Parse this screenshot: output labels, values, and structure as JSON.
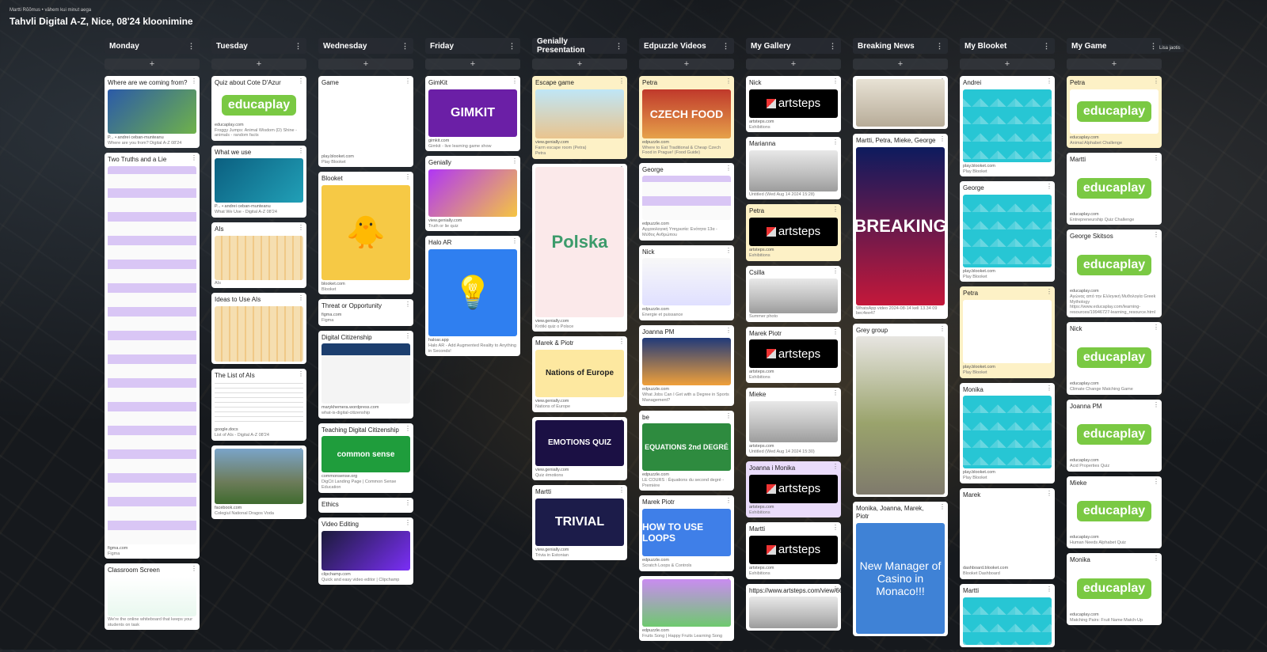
{
  "header": {
    "crumb": "Martti Rõõmus • vähem kui minut aega",
    "title": "Tahvli Digital A-Z, Nice, 08'24 kloonimine"
  },
  "side_label": "Lisa jaotis",
  "columns": [
    {
      "title": "Monday",
      "cards": [
        {
          "title": "Where are we coming from?",
          "style": "white",
          "thumb": "map",
          "thumb_h": 56,
          "domain": "P... • andrei ceban-munteanu",
          "caption": "Where are you from? Digital A-Z 08'24"
        },
        {
          "title": "Two Truths and a Lie",
          "style": "white",
          "thumb": "doc",
          "thumb_h": 478,
          "domain": "figma.com",
          "caption": "Figma"
        },
        {
          "title": "Classroom Screen",
          "style": "white",
          "thumb": "classroom",
          "thumb_h": 50,
          "domain": "",
          "caption": "We're the online whiteboard that keeps your students on task"
        }
      ]
    },
    {
      "title": "Tuesday",
      "cards": [
        {
          "title": "Quiz about Cote D'Azur",
          "style": "white",
          "thumb": "educaplay",
          "thumb_h": 40,
          "domain": "educaplay.com",
          "caption": "Froggy Jumps: Animal Wisdom (D) Shine - animals - random facts"
        },
        {
          "title": "What we use",
          "style": "white",
          "thumb": "ocean",
          "thumb_h": 56,
          "domain": "P... • andrei ceban-munteanu",
          "caption": "What We Use - Digital A-Z 08'24"
        },
        {
          "title": "AIs",
          "style": "white",
          "thumb": "chart",
          "thumb_h": 56,
          "domain": "",
          "caption": "AIs"
        },
        {
          "title": "Ideas to Use AIs",
          "style": "white",
          "thumb": "chart",
          "thumb_h": 70,
          "domain": "",
          "caption": ""
        },
        {
          "title": "The List of AIs",
          "style": "white",
          "thumb": "sheet",
          "thumb_h": 56,
          "domain": "google.docs",
          "caption": "List of AIs - Digital A-Z 08'24"
        },
        {
          "title": "",
          "style": "white",
          "thumb": "building",
          "thumb_h": 70,
          "domain": "facebook.com",
          "caption": "Colegiul National Dragos Voda"
        }
      ]
    },
    {
      "title": "Wednesday",
      "cards": [
        {
          "title": "Game",
          "style": "white",
          "thumb": "blank",
          "thumb_h": 80,
          "domain": "play.blooket.com",
          "caption": "Play Blooket"
        },
        {
          "title": "Blooket",
          "style": "white",
          "thumb": "blooket-chick",
          "thumb_h": 120,
          "domain": "blooket.com",
          "caption": "Blooket"
        },
        {
          "title": "Threat or Opportunity",
          "style": "white",
          "thumb": "none",
          "thumb_h": 0,
          "domain": "figma.com",
          "caption": "Figma"
        },
        {
          "title": "Digital Citizenship",
          "style": "white",
          "thumb": "web",
          "thumb_h": 76,
          "domain": "marykhemera.wordpress.com",
          "caption": "what-is-digital-citizenship"
        },
        {
          "title": "Teaching Digital Citizenship",
          "style": "white",
          "thumb": "commonsense",
          "thumb_h": 46,
          "domain": "commonsense.org",
          "caption": "DigCit Landing Page | Common Sense Education"
        },
        {
          "title": "Ethics",
          "style": "white",
          "thumb": "none",
          "thumb_h": 0,
          "domain": "",
          "caption": ""
        },
        {
          "title": "Video Editing",
          "style": "white",
          "thumb": "video",
          "thumb_h": 50,
          "domain": "clipchamp.com",
          "caption": "Quick and easy video editor | Clipchamp"
        }
      ]
    },
    {
      "title": "Friday",
      "cards": [
        {
          "title": "GimKit",
          "style": "white",
          "thumb": "gimkit",
          "thumb_h": 60,
          "domain": "gimkit.com",
          "caption": "Gimkit - live learning game show"
        },
        {
          "title": "Genially",
          "style": "white",
          "thumb": "genially",
          "thumb_h": 60,
          "domain": "view.genially.com",
          "caption": "Truth or lie quiz"
        },
        {
          "title": "Halo AR",
          "style": "white",
          "thumb": "halo",
          "thumb_h": 110,
          "domain": "haloar.app",
          "caption": "Halo AR - Add Augmented Reality to Anything in Seconds!"
        }
      ]
    },
    {
      "title": "Genially Presentation",
      "cards": [
        {
          "title": "Escape game",
          "style": "yellow",
          "thumb": "escape",
          "thumb_h": 62,
          "domain": "view.genially.com",
          "caption": "Farm escape room (Petra)",
          "caption2": "Petra"
        },
        {
          "title": "",
          "style": "white",
          "thumb": "polska",
          "thumb_h": 190,
          "domain": "view.genially.com",
          "caption": "Krótki quiz o Polsce"
        },
        {
          "title": "Marek & Piotr",
          "style": "white",
          "thumb": "nations",
          "thumb_h": 60,
          "domain": "view.genially.com",
          "caption": "Nations of Europe"
        },
        {
          "title": "",
          "style": "white",
          "thumb": "emotions",
          "thumb_h": 58,
          "domain": "view.genially.com",
          "caption": "Quiz émotions"
        },
        {
          "title": "Martti",
          "style": "white",
          "thumb": "trivial",
          "thumb_h": 60,
          "domain": "view.genially.com",
          "caption": "Trivia in Estonian"
        }
      ]
    },
    {
      "title": "Edpuzzle Videos",
      "cards": [
        {
          "title": "Petra",
          "style": "yellow",
          "thumb": "czech",
          "thumb_h": 62,
          "domain": "edpuzzle.com",
          "caption": "Where to Eat Traditional & Cheap Czech Food in Prague! (Food Guide)"
        },
        {
          "title": "George",
          "style": "white",
          "thumb": "doc",
          "thumb_h": 56,
          "domain": "edpuzzle.com",
          "caption": "Αρχαιολογική Υπηρεσία: Ενότητα 13α - Μύθος Ανθρώπου"
        },
        {
          "title": "Nick",
          "style": "white",
          "thumb": "energy",
          "thumb_h": 60,
          "domain": "edpuzzle.com",
          "caption": "Energie et puissance"
        },
        {
          "title": "Joanna PM",
          "style": "white",
          "thumb": "sports",
          "thumb_h": 60,
          "domain": "edpuzzle.com",
          "caption": "What Jobs Can I Get with a Degree in Sports Management?"
        },
        {
          "title": "be",
          "style": "white",
          "thumb": "equations",
          "thumb_h": 60,
          "domain": "edpuzzle.com",
          "caption": "LE COURS : Équations du second degré - Première"
        },
        {
          "title": "Marek Piotr",
          "style": "white",
          "thumb": "loops",
          "thumb_h": 60,
          "domain": "edpuzzle.com",
          "caption": "Scratch Loops & Controls"
        },
        {
          "title": "",
          "style": "white",
          "thumb": "fruits",
          "thumb_h": 60,
          "domain": "edpuzzle.com",
          "caption": "Fruits Song | Happy Fruits Learning Song"
        }
      ]
    },
    {
      "title": "My Gallery",
      "cards": [
        {
          "title": "Nick",
          "style": "white",
          "thumb": "artsteps",
          "thumb_h": 36,
          "domain": "artsteps.com",
          "caption": "Exhibitions"
        },
        {
          "title": "Marianna",
          "style": "white",
          "thumb": "room",
          "thumb_h": 52,
          "domain": "",
          "caption": "Untitled (Wed Aug 14 2024 15:28)"
        },
        {
          "title": "Petra",
          "style": "yellow",
          "thumb": "artsteps",
          "thumb_h": 36,
          "domain": "artsteps.com",
          "caption": "Exhibitions"
        },
        {
          "title": "Csilla",
          "style": "white",
          "thumb": "room",
          "thumb_h": 44,
          "domain": "",
          "caption": "Summer photo"
        },
        {
          "title": "Marek Piotr",
          "style": "white",
          "thumb": "artsteps",
          "thumb_h": 36,
          "domain": "artsteps.com",
          "caption": "Exhibitions"
        },
        {
          "title": "Mieke",
          "style": "white",
          "thumb": "room",
          "thumb_h": 52,
          "domain": "artsteps.com",
          "caption": "Untitled (Wed Aug 14 2024 15:30)"
        },
        {
          "title": "Joanna i Monika",
          "style": "purple",
          "thumb": "artsteps",
          "thumb_h": 36,
          "domain": "artsteps.com",
          "caption": "Exhibitions"
        },
        {
          "title": "Martti",
          "style": "white",
          "thumb": "artsteps",
          "thumb_h": 36,
          "domain": "artsteps.com",
          "caption": "Exhibitions"
        },
        {
          "title": "https://www.artsteps.com/view/66bcb1175f40d7345475d1d5",
          "style": "white",
          "thumb": "room",
          "thumb_h": 40,
          "domain": "",
          "caption": ""
        }
      ]
    },
    {
      "title": "Breaking News",
      "cards": [
        {
          "title": "",
          "style": "white",
          "thumb": "news1",
          "thumb_h": 60,
          "domain": "",
          "caption": ""
        },
        {
          "title": "Martti, Petra, Mieke, George",
          "style": "white",
          "thumb": "breaking",
          "thumb_h": 200,
          "domain": "",
          "caption": "WhatsApp video 2024-08-14 kell 13.34 09 bec4ee47"
        },
        {
          "title": "Grey group",
          "style": "white",
          "thumb": "street",
          "thumb_h": 200,
          "domain": "",
          "caption": ""
        },
        {
          "title": "Monika, Joanna, Marek, Piotr",
          "style": "white",
          "thumb": "casino",
          "thumb_h": 140,
          "domain": "",
          "caption": ""
        }
      ]
    },
    {
      "title": "My Blooket",
      "cards": [
        {
          "title": "Andrei",
          "style": "white",
          "thumb": "blooket",
          "thumb_h": 92,
          "domain": "play.blooket.com",
          "caption": "Play Blooket"
        },
        {
          "title": "George",
          "style": "white",
          "thumb": "blooket",
          "thumb_h": 92,
          "domain": "play.blooket.com",
          "caption": "Play Blooket"
        },
        {
          "title": "Petra",
          "style": "yellow",
          "thumb": "blank",
          "thumb_h": 80,
          "domain": "play.blooket.com",
          "caption": "Play Blooket"
        },
        {
          "title": "Monika",
          "style": "white",
          "thumb": "blooket",
          "thumb_h": 92,
          "domain": "play.blooket.com",
          "caption": "Play Blooket"
        },
        {
          "title": "Marek",
          "style": "white",
          "thumb": "blank",
          "thumb_h": 80,
          "domain": "dashboard.blooket.com",
          "caption": "Blooket Dashboard"
        },
        {
          "title": "Martti",
          "style": "white",
          "thumb": "blooket",
          "thumb_h": 60,
          "domain": "",
          "caption": ""
        }
      ]
    },
    {
      "title": "My Game",
      "cards": [
        {
          "title": "Petra",
          "style": "yellow",
          "thumb": "educaplay",
          "thumb_h": 56,
          "domain": "educaplay.com",
          "caption": "Animal Alphabet Challenge"
        },
        {
          "title": "Martti",
          "style": "white",
          "thumb": "educaplay",
          "thumb_h": 56,
          "domain": "educaplay.com",
          "caption": "Entrepreneurship Quiz Challenge"
        },
        {
          "title": "George Skitsos",
          "style": "white",
          "thumb": "educaplay",
          "thumb_h": 56,
          "domain": "educaplay.com",
          "caption": "Αγώνας από την Ελληνική Μυθολογία Greek Mythology https://www.educaplay.com/learning-resources/19946727-learning_resource.html"
        },
        {
          "title": "Nick",
          "style": "white",
          "thumb": "educaplay",
          "thumb_h": 56,
          "domain": "educaplay.com",
          "caption": "Climate Change Matching Game"
        },
        {
          "title": "Joanna PM",
          "style": "white",
          "thumb": "educaplay",
          "thumb_h": 56,
          "domain": "educaplay.com",
          "caption": "Acid Properties Quiz"
        },
        {
          "title": "Mieke",
          "style": "white",
          "thumb": "educaplay",
          "thumb_h": 56,
          "domain": "educaplay.com",
          "caption": "Human Needs Alphabet Quiz"
        },
        {
          "title": "Monika",
          "style": "white",
          "thumb": "educaplay",
          "thumb_h": 56,
          "domain": "educaplay.com",
          "caption": "Matching Pairs: Fruit Name Match-Up"
        }
      ]
    }
  ],
  "icons": {
    "column_menu": "dots-vertical-icon",
    "add": "plus-icon",
    "card_menu": "dots-vertical-icon"
  },
  "colors": {
    "educaplay": "#7ac943",
    "blooket": "#27c6d4",
    "card_yellow": "#fdf1c6",
    "card_purple": "#eadcfb"
  }
}
